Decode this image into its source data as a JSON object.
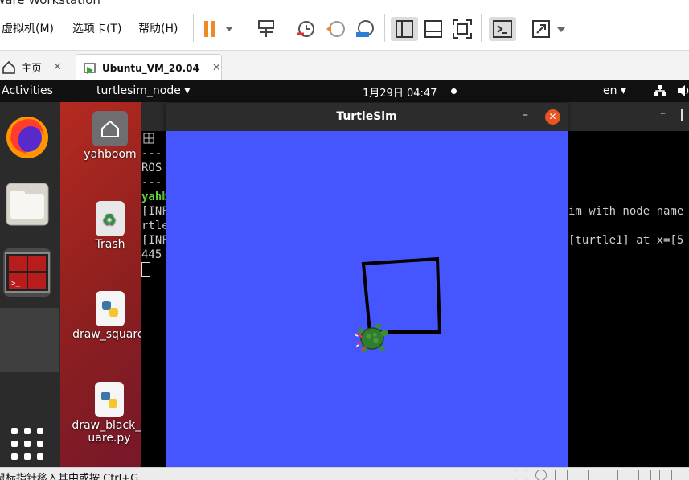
{
  "vmware": {
    "title": "ware Workstation",
    "menu": [
      "虚拟机(M)",
      "选项卡(T)",
      "帮助(H)"
    ]
  },
  "tabs": [
    {
      "label": "主页",
      "close": "✕"
    },
    {
      "label": "Ubuntu_VM_20.04",
      "close": "✕"
    }
  ],
  "guest": {
    "topbar": {
      "activities": "Activities",
      "app_menu": "turtlesim_node ▾",
      "clock": "1月29日  04:47",
      "lang": "en ▾"
    },
    "desktop_icons": [
      {
        "label": "yahboom",
        "icon": "home-folder-icon"
      },
      {
        "label": "Trash",
        "icon": "trash-icon"
      },
      {
        "label": "draw_square.",
        "icon": "python-file-icon"
      },
      {
        "label": "draw_black_s uare.py",
        "icon": "python-file-icon"
      }
    ],
    "dock": [
      "firefox-icon",
      "files-icon",
      "terminal-icon",
      "show-apps-icon"
    ],
    "terminal": {
      "lines": [
        "---",
        "ROS",
        "---",
        "yahb",
        "[INF",
        "rtle",
        "[INF",
        "445"
      ],
      "right_lines": [
        "im with node name",
        "[turtle1] at x=[5"
      ]
    },
    "turtlesim": {
      "title": "TurtleSim",
      "bg_color": "#4556ff"
    }
  },
  "statusbar": {
    "text": "鼠标指针移入其中或按 Ctrl+G"
  },
  "colors": {
    "accent": "#ef8a2b",
    "close_button": "#e95420",
    "turtlesim_bg": "#4556ff"
  }
}
